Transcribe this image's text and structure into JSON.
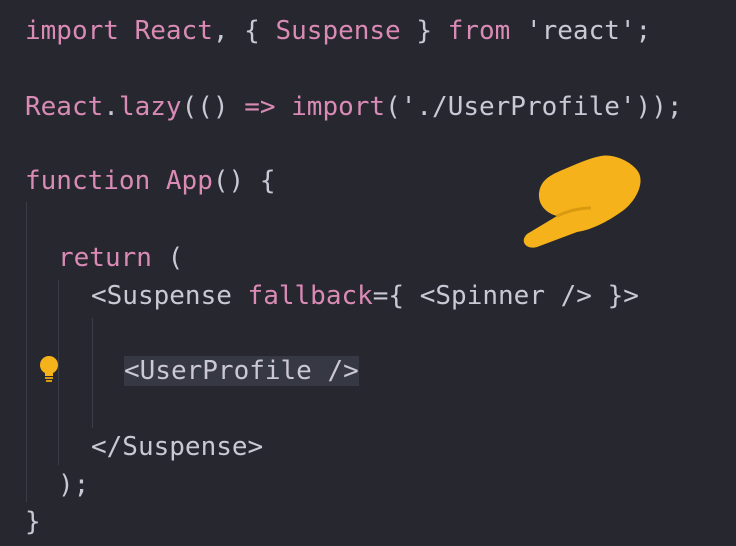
{
  "editor": {
    "line1": {
      "import_kw": "import",
      "react": "React",
      "comma": ",",
      "lbrace": "{",
      "suspense": "Suspense",
      "rbrace": "}",
      "from_kw": "from",
      "module": "'react'",
      "semi": ";"
    },
    "line2": {
      "react": "React",
      "dot": ".",
      "lazy": "lazy",
      "open": "(()",
      "arrow": "=>",
      "import_kw": "import",
      "path_open": "(",
      "path": "'./UserProfile'",
      "close": "));"
    },
    "line3": {
      "function_kw": "function",
      "name": "App",
      "rest": "() {"
    },
    "line4": {
      "return_kw": "return",
      "paren": "("
    },
    "line5": {
      "open": "<Suspense",
      "attr": "fallback",
      "rest": "={ <Spinner /> }>"
    },
    "line6": {
      "text": "<UserProfile />"
    },
    "line7": {
      "text": "</Suspense>"
    },
    "line8": {
      "text": ");"
    },
    "line9": {
      "text": "}"
    }
  },
  "icons": {
    "lightbulb": "lightbulb-icon",
    "pointer": "pointing-hand-icon"
  },
  "colors": {
    "background": "#27282f",
    "keyword": "#d98ab5",
    "text": "#cbc8d6",
    "accent": "#f5b21b"
  }
}
